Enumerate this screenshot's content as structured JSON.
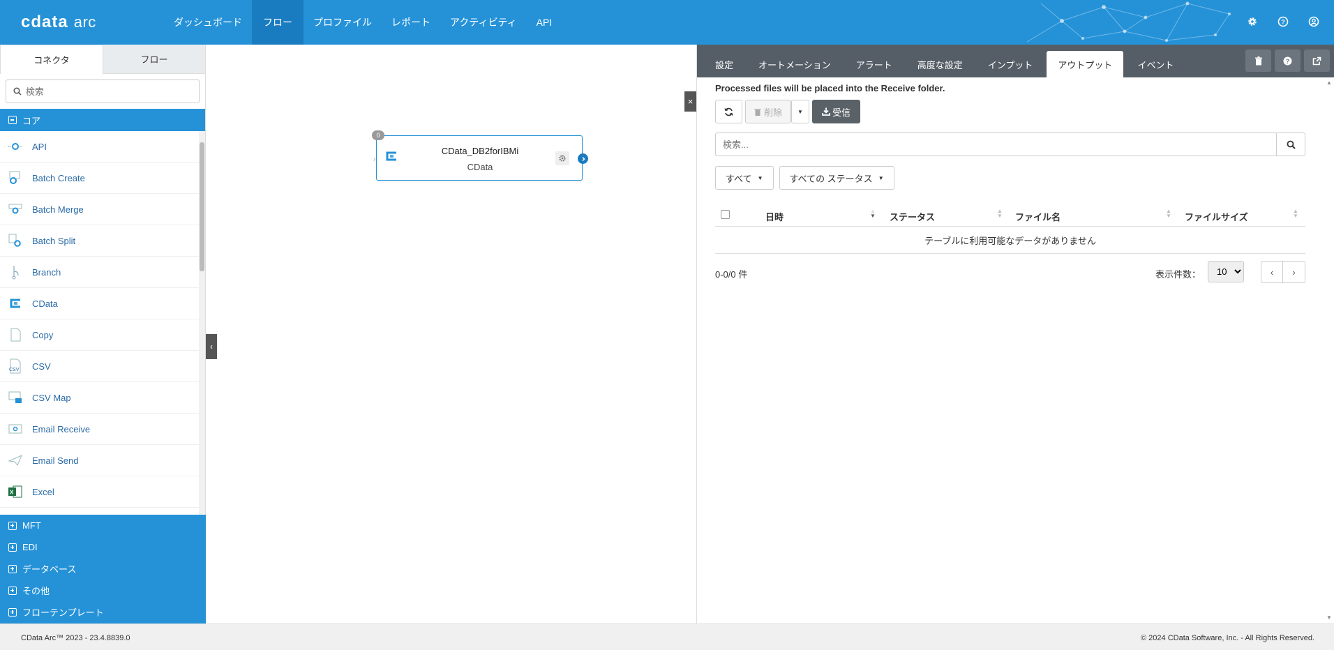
{
  "app": {
    "brand": "cdata",
    "product": "arc"
  },
  "nav": {
    "items": [
      {
        "label": "ダッシュボード",
        "active": false
      },
      {
        "label": "フロー",
        "active": true
      },
      {
        "label": "プロファイル",
        "active": false
      },
      {
        "label": "レポート",
        "active": false
      },
      {
        "label": "アクティビティ",
        "active": false
      },
      {
        "label": "API",
        "active": false
      }
    ]
  },
  "top_icons": [
    "gear-icon",
    "help-icon",
    "user-icon"
  ],
  "sidebar": {
    "tabs": [
      {
        "label": "コネクタ",
        "active": true
      },
      {
        "label": "フロー",
        "active": false
      }
    ],
    "search_placeholder": "検索",
    "core_section": "コア",
    "connectors": [
      {
        "label": "API",
        "icon": "api-icon"
      },
      {
        "label": "Batch Create",
        "icon": "batch-create-icon"
      },
      {
        "label": "Batch Merge",
        "icon": "batch-merge-icon"
      },
      {
        "label": "Batch Split",
        "icon": "batch-split-icon"
      },
      {
        "label": "Branch",
        "icon": "branch-icon"
      },
      {
        "label": "CData",
        "icon": "cdata-icon"
      },
      {
        "label": "Copy",
        "icon": "copy-icon"
      },
      {
        "label": "CSV",
        "icon": "csv-icon"
      },
      {
        "label": "CSV Map",
        "icon": "csv-map-icon"
      },
      {
        "label": "Email Receive",
        "icon": "email-receive-icon"
      },
      {
        "label": "Email Send",
        "icon": "email-send-icon"
      },
      {
        "label": "Excel",
        "icon": "excel-icon"
      }
    ],
    "sections": [
      "MFT",
      "EDI",
      "データベース",
      "その他",
      "フローテンプレート"
    ]
  },
  "canvas": {
    "node": {
      "name": "CData_DB2forIBMi",
      "type": "CData",
      "badge": "0"
    }
  },
  "panel": {
    "tabs": [
      {
        "label": "設定",
        "active": false
      },
      {
        "label": "オートメーション",
        "active": false
      },
      {
        "label": "アラート",
        "active": false
      },
      {
        "label": "高度な設定",
        "active": false
      },
      {
        "label": "インプット",
        "active": false
      },
      {
        "label": "アウトプット",
        "active": true
      },
      {
        "label": "イベント",
        "active": false
      }
    ],
    "note": "Processed files will be placed into the  Receive folder.",
    "buttons": {
      "delete": "削除",
      "receive": "受信"
    },
    "search_placeholder": "検索...",
    "filters": {
      "all": "すべて",
      "status": "すべての ステータス"
    },
    "columns": [
      "日時",
      "ステータス",
      "ファイル名",
      "ファイルサイズ"
    ],
    "empty": "テーブルに利用可能なデータがありません",
    "count": "0-0/0 件",
    "per_page_label": "表示件数：",
    "per_page": "10"
  },
  "footer": {
    "version": "CData Arc™ 2023 - 23.4.8839.0",
    "copyright": "© 2024 CData Software, Inc. - All Rights Reserved."
  },
  "colors": {
    "primary": "#2592d8",
    "nav_active": "#1a7cc0",
    "panel_tabs": "#555e66"
  }
}
